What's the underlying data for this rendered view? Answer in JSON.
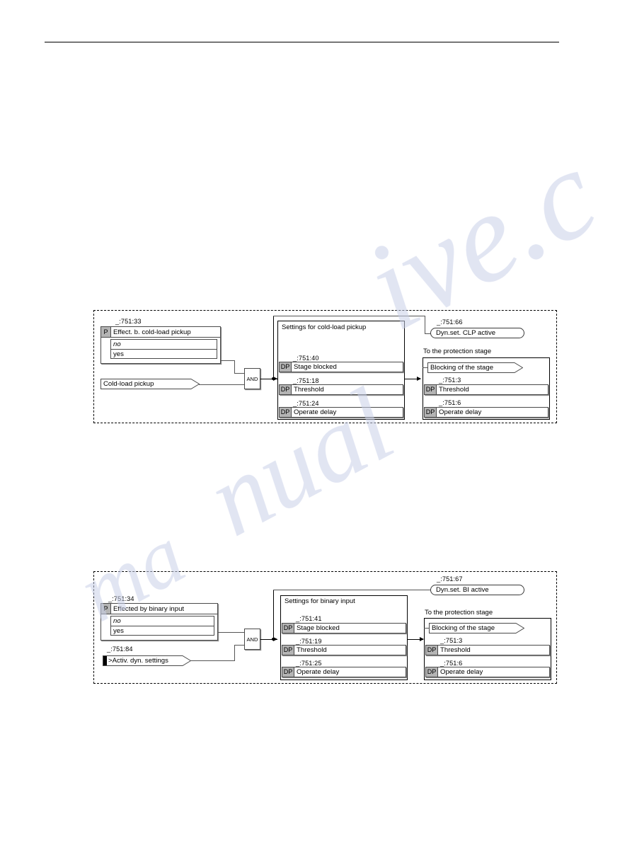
{
  "document": {
    "rule_present": true
  },
  "figures": [
    {
      "id": "figure-1",
      "parameter_ref": "_:751:33",
      "parameter_label": "Effect. b. cold-load pickup",
      "parameter_tag": "P",
      "options": [
        "no",
        "yes"
      ],
      "input_flag": "Cold-load pickup",
      "gate": "AND",
      "settings_group_title": "Settings for cold-load pickup",
      "settings_rows": [
        {
          "ref": "_:751:40",
          "tag": "DP",
          "label": "Stage blocked"
        },
        {
          "ref": "_:751:18",
          "tag": "DP",
          "label": "Threshold"
        },
        {
          "ref": "_:751:24",
          "tag": "DP",
          "label": "Operate delay"
        }
      ],
      "output_ref": "_:751:66",
      "output_label": "Dyn.set. CLP active",
      "protection_title": "To the protection stage",
      "protection_flag": "Blocking of the stage",
      "protection_rows": [
        {
          "ref": "_:751:3",
          "tag": "DP",
          "label": "Threshold"
        },
        {
          "ref": "_:751:6",
          "tag": "DP",
          "label": "Operate delay"
        }
      ]
    },
    {
      "id": "figure-2",
      "parameter_ref": "_:751:34",
      "parameter_label": "Effected by binary input",
      "parameter_tag": "P",
      "options": [
        "no",
        "yes"
      ],
      "input_ref": "_:751:84",
      "input_flag": ">Activ. dyn. settings",
      "gate": "AND",
      "settings_group_title": "Settings for binary input",
      "settings_rows": [
        {
          "ref": "_:751:41",
          "tag": "DP",
          "label": "Stage blocked"
        },
        {
          "ref": "_:751:19",
          "tag": "DP",
          "label": "Threshold"
        },
        {
          "ref": "_:751:25",
          "tag": "DP",
          "label": "Operate delay"
        }
      ],
      "output_ref": "_:751:67",
      "output_label": "Dyn.set. BI active",
      "protection_title": "To the protection stage",
      "protection_flag": "Blocking of the stage",
      "protection_rows": [
        {
          "ref": "_:751:3",
          "tag": "DP",
          "label": "Threshold"
        },
        {
          "ref": "_:751:6",
          "tag": "DP",
          "label": "Operate delay"
        }
      ]
    }
  ],
  "colors": {
    "tag_fill": "#b4b4b4",
    "line": "#000000",
    "box_border": "#4a4a4a"
  }
}
